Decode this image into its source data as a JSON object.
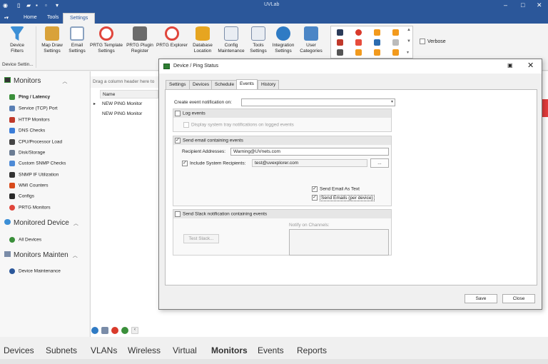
{
  "app": {
    "title": "UVLab"
  },
  "ribbon_tabs": [
    "Home",
    "Tools",
    "Settings"
  ],
  "ribbon": {
    "buttons": [
      {
        "label": "Device Filters",
        "icon": "funnel-icon",
        "color": "#3c8fd6"
      },
      {
        "label": "Map Draw Settings",
        "icon": "map-draw-icon",
        "color": "#d9a23a"
      },
      {
        "label": "Email Settings",
        "icon": "envelope-icon",
        "color": "#8aa2c0"
      },
      {
        "label": "PRTG Template Settings",
        "icon": "gauge-icon",
        "color": "#e0463c"
      },
      {
        "label": "PRTG Plugin Register",
        "icon": "plugin-icon",
        "color": "#6b6b6b"
      },
      {
        "label": "PRTG Explorer",
        "icon": "gauge-icon",
        "color": "#e0463c"
      },
      {
        "label": "Database Location",
        "icon": "database-icon",
        "color": "#e6a520"
      },
      {
        "label": "Config Maintenance",
        "icon": "config-icon",
        "color": "#7a8ca8"
      },
      {
        "label": "Tools Settings",
        "icon": "tools-icon",
        "color": "#7a8ca8"
      },
      {
        "label": "Integration Settings",
        "icon": "globe-icon",
        "color": "#2f7bc4"
      },
      {
        "label": "User Categories",
        "icon": "categories-icon",
        "color": "#4b86c6"
      }
    ],
    "group_label": "Device Settin...",
    "verbose_label": "Verbose"
  },
  "left_panel": {
    "monitors_title": "Monitors",
    "monitor_items": [
      {
        "label": "Ping / Latency",
        "color": "#3a8f3a"
      },
      {
        "label": "Service (TCP) Port",
        "color": "#5a7fb4"
      },
      {
        "label": "HTTP Monitors",
        "color": "#c0392b"
      },
      {
        "label": "DNS Checks",
        "color": "#3b7dd8"
      },
      {
        "label": "CPU/Processor Load",
        "color": "#444444"
      },
      {
        "label": "Disk/Storage",
        "color": "#6b7c93"
      },
      {
        "label": "Custom SNMP Checks",
        "color": "#4d8ad6"
      },
      {
        "label": "SNMP IF Utilization",
        "color": "#333333"
      },
      {
        "label": "WMI Counters",
        "color": "#d84a1b"
      },
      {
        "label": "Configs",
        "color": "#2a2a2a"
      },
      {
        "label": "PRTG Monitors",
        "color": "#e0463c"
      }
    ],
    "monitored_title": "Monitored Device",
    "monitored_items": [
      {
        "label": "All Devices",
        "color": "#3a8f3a"
      }
    ],
    "maint_title": "Monitors Mainten",
    "maint_items": [
      {
        "label": "Device Maintenance",
        "color": "#2b579a"
      }
    ]
  },
  "grid": {
    "group_hint": "Drag a column header here to",
    "column_name": "Name",
    "rows": [
      "NEW PING Monitor",
      "NEW PING Monitor"
    ]
  },
  "bottom_tabs": [
    "Devices",
    "Subnets",
    "VLANs",
    "Wireless",
    "Virtual",
    "Monitors",
    "Events",
    "Reports"
  ],
  "dialog": {
    "title": "Device / Ping Status",
    "tabs": [
      "Settings",
      "Devices",
      "Schedule",
      "Events",
      "History"
    ],
    "create_label": "Create event notification on:",
    "create_value": "",
    "log_section": "Log events",
    "log_tray": "Display system tray notifications on logged events",
    "email_section": "Send email containing events",
    "recipient_label": "Recipient Addresses:",
    "recipient_value": "Warning@UVnets.com",
    "include_label": "Include System Recipients:",
    "include_value": "test@uvexplorer.com",
    "dots_button": "...",
    "send_text": "Send Email As Text",
    "send_per_device": "Send Emails (per device)",
    "slack_section": "Send Slack notification containing events",
    "test_slack": "Test Slack...",
    "notify_label": "Notify on Channels:",
    "save": "Save",
    "close": "Close"
  }
}
